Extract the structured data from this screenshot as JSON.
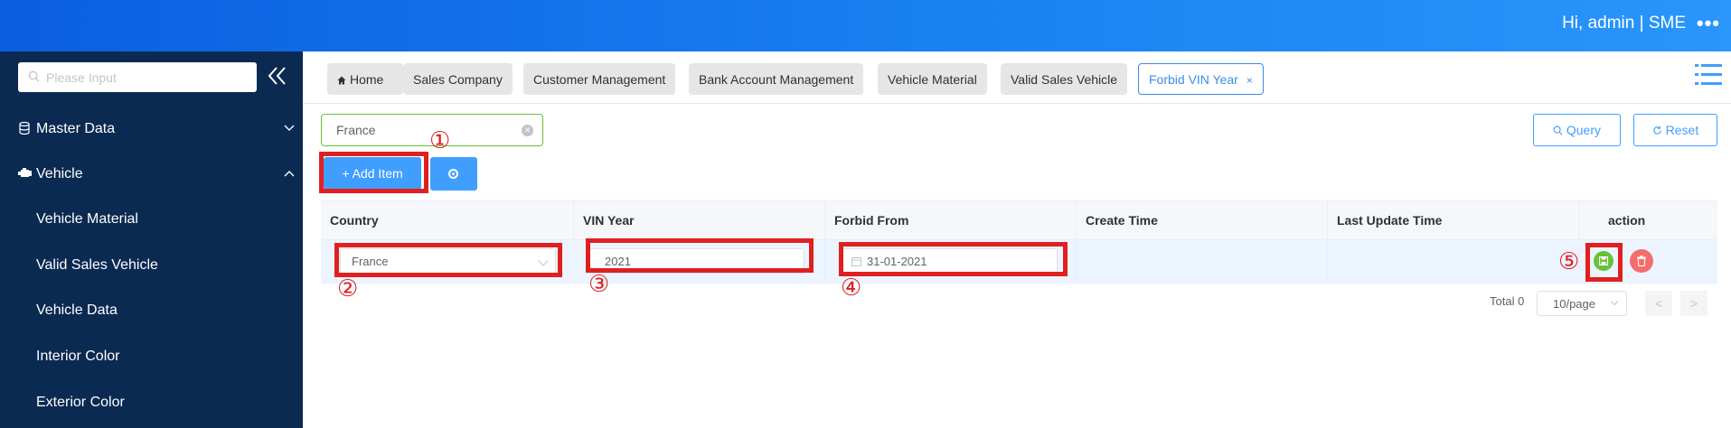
{
  "header": {
    "user_text": "Hi, admin | SME",
    "more_label": "•••"
  },
  "sidebar": {
    "search_placeholder": "Please Input",
    "items": [
      {
        "label": "Master Data",
        "icon": "database-icon",
        "expanded": false
      },
      {
        "label": "Vehicle",
        "icon": "engine-icon",
        "expanded": true
      }
    ],
    "subitems": [
      "Vehicle Material",
      "Valid Sales Vehicle",
      "Vehicle Data",
      "Interior Color",
      "Exterior Color"
    ]
  },
  "tabs": [
    {
      "label": "Home",
      "icon": "home-icon"
    },
    {
      "label": "Sales Company"
    },
    {
      "label": "Customer Management"
    },
    {
      "label": "Bank Account Management"
    },
    {
      "label": "Vehicle Material"
    },
    {
      "label": "Valid Sales Vehicle"
    },
    {
      "label": "Forbid VIN Year",
      "active": true,
      "close": "×"
    }
  ],
  "filter": {
    "country_value": "France"
  },
  "toolbar": {
    "query_label": "Query",
    "reset_label": "Reset",
    "add_label": "+ Add Item"
  },
  "table": {
    "columns": [
      "Country",
      "VIN Year",
      "Forbid From",
      "Create Time",
      "Last Update Time",
      "action"
    ],
    "rows": [
      {
        "country": "France",
        "vin_year": "2021",
        "forbid_from": "31-01-2021",
        "create_time": "",
        "last_update_time": ""
      }
    ]
  },
  "annotations": [
    "①",
    "②",
    "③",
    "④",
    "⑤"
  ],
  "pagination": {
    "total": "Total 0",
    "page_size": "10/page",
    "prev": "<",
    "next": ">"
  },
  "colors": {
    "header_blue": "#1a84f3",
    "sidebar": "#0b2a52",
    "primary": "#409eff",
    "highlight": "#e02020",
    "save": "#67c23a",
    "delete": "#f56c6c"
  }
}
